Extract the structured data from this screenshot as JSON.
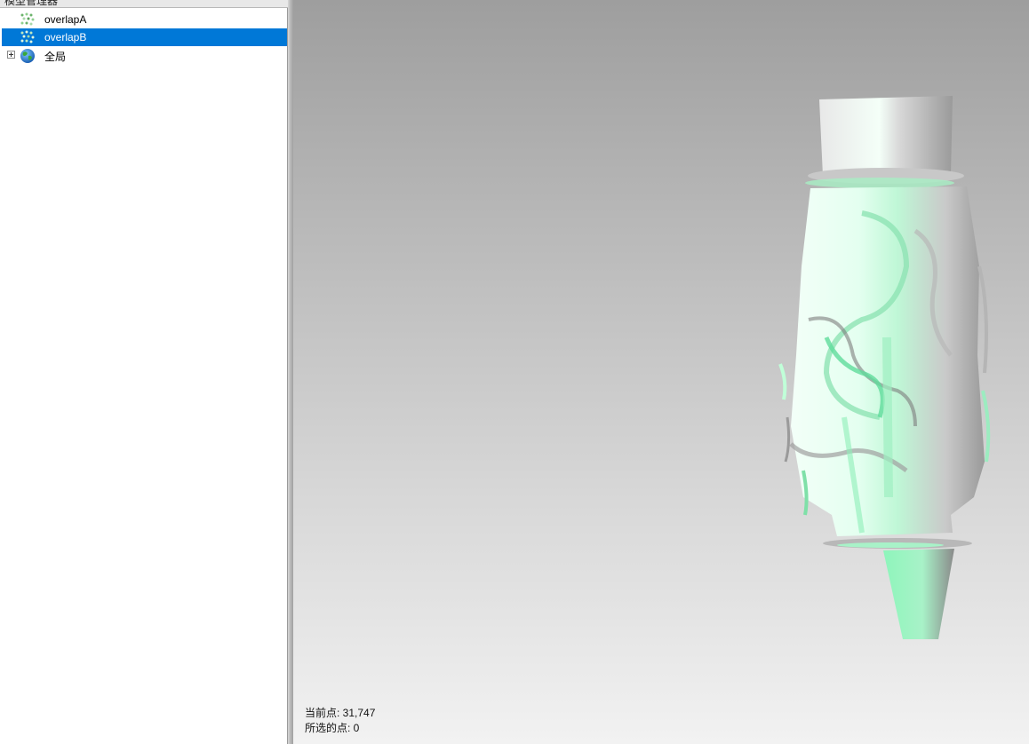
{
  "panel": {
    "title": "模型管理器",
    "buttons": [
      "▾",
      "ᛙ",
      "✕"
    ]
  },
  "tree": {
    "items": [
      {
        "label": "overlapA",
        "icon": "point-cloud-icon",
        "selected": false,
        "expandable": false
      },
      {
        "label": "overlapB",
        "icon": "point-cloud-icon",
        "selected": true,
        "expandable": false
      },
      {
        "label": "全局",
        "icon": "globe-icon",
        "selected": false,
        "expandable": true
      }
    ]
  },
  "viewport": {
    "current_points_label": "当前点: 31,747",
    "selected_points_label": "所选的点: 0"
  },
  "colors": {
    "selection": "#0078d7",
    "cloud_green": "#9ff5c6",
    "cloud_gray": "#8f8f8f"
  }
}
